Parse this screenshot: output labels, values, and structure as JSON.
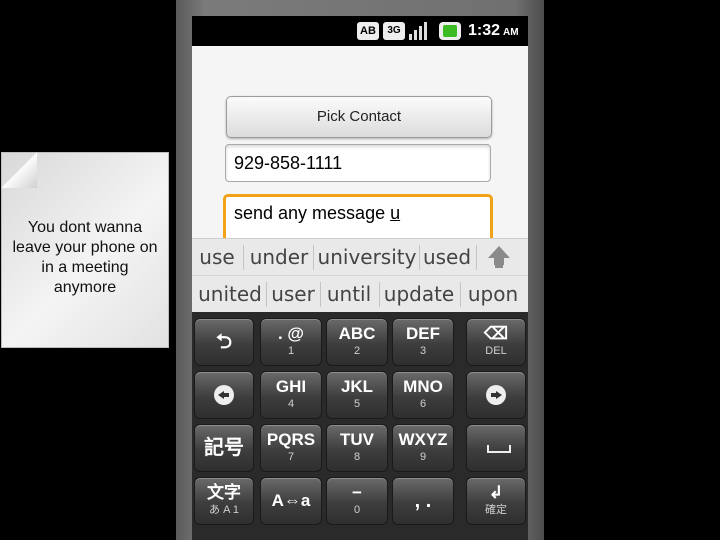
{
  "note": {
    "text": "You dont wanna leave your phone on in a meeting anymore"
  },
  "statusbar": {
    "ab": "AB",
    "network": "3G",
    "time": "1:32",
    "ampm": "AM"
  },
  "form": {
    "pick_contact_label": "Pick Contact",
    "phone_value": "929-858-1111",
    "message_value": "send any message ",
    "message_composing": "u"
  },
  "suggestions": {
    "row1": [
      "use",
      "under",
      "university",
      "used"
    ],
    "row2": [
      "united",
      "user",
      "until",
      "update",
      "upon"
    ]
  },
  "keyboard": {
    "row1": [
      {
        "name": "back-key",
        "icon": "return-arrow-icon"
      },
      {
        "main": ". @",
        "sub": "1"
      },
      {
        "main": "ABC",
        "sub": "2"
      },
      {
        "main": "DEF",
        "sub": "3"
      },
      {
        "name": "delete-key",
        "icon": "backspace-icon",
        "sub": "DEL"
      }
    ],
    "row2": [
      {
        "name": "left-key",
        "icon": "left-arrow-circle-icon"
      },
      {
        "main": "GHI",
        "sub": "4"
      },
      {
        "main": "JKL",
        "sub": "5"
      },
      {
        "main": "MNO",
        "sub": "6"
      },
      {
        "name": "right-key",
        "icon": "right-arrow-circle-icon"
      }
    ],
    "row3": [
      {
        "name": "symbol-key",
        "main": "記号"
      },
      {
        "main": "PQRS",
        "sub": "7"
      },
      {
        "main": "TUV",
        "sub": "8"
      },
      {
        "main": "WXYZ",
        "sub": "9"
      },
      {
        "name": "space-key",
        "icon": "space-icon"
      }
    ],
    "row4": [
      {
        "name": "mode-key",
        "main": "文字",
        "sub": "あ A 1"
      },
      {
        "main": "A⇔a"
      },
      {
        "main": "−",
        "sub": "0"
      },
      {
        "main": ",  ."
      },
      {
        "name": "enter-key",
        "icon": "enter-icon",
        "sub": "確定"
      }
    ]
  }
}
